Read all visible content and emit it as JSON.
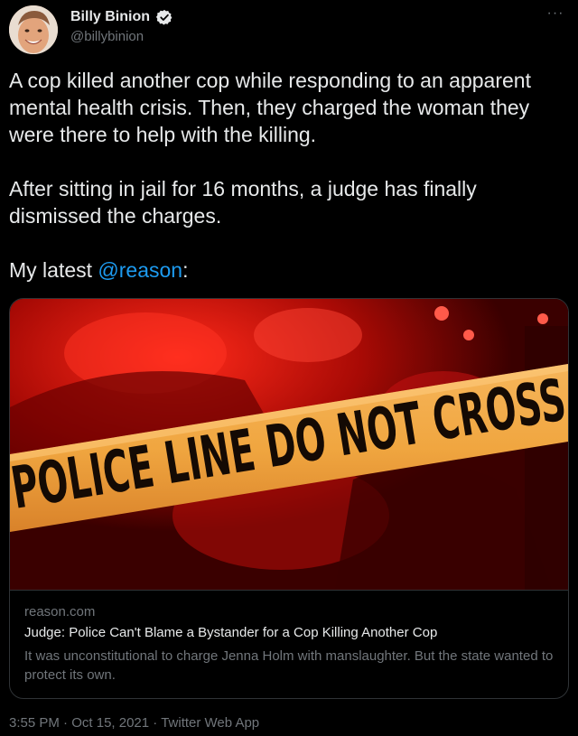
{
  "author": {
    "display_name": "Billy Binion",
    "handle": "@billybinion",
    "verified": true,
    "avatar_icon": "avatar-photo"
  },
  "menu_icon": "more-horizontal-icon",
  "tweet": {
    "para1": "A cop killed another cop while responding to an apparent mental health crisis. Then, they charged the woman they were there to help with the killing.",
    "para2": "After sitting in jail for 16 months, a judge has finally dismissed the charges.",
    "para3_prefix": "My latest ",
    "para3_mention": "@reason",
    "para3_suffix": ":"
  },
  "card": {
    "image_text": "POLICE LINE DO NOT CROSS",
    "domain": "reason.com",
    "title": "Judge: Police Can't Blame a Bystander for a Cop Killing Another Cop",
    "description": "It was unconstitutional to charge Jenna Holm with manslaughter. But the state wanted to protect its own."
  },
  "footer": {
    "time": "3:55 PM",
    "separator": "·",
    "date": "Oct 15, 2021",
    "source": "Twitter Web App"
  },
  "colors": {
    "background": "#000000",
    "text": "#e7e9ea",
    "secondary": "#71767b",
    "link": "#1d9bf0",
    "tape": "#f0a640"
  }
}
